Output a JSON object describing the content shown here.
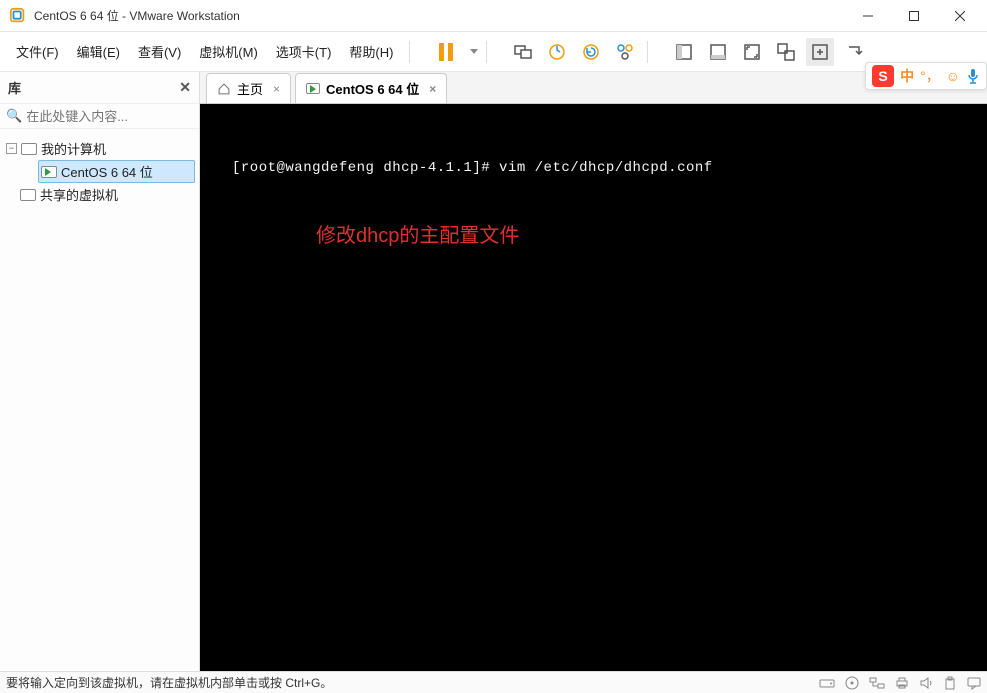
{
  "titlebar": {
    "title": "CentOS 6 64 位 - VMware Workstation"
  },
  "menu": {
    "file": "文件(F)",
    "edit": "编辑(E)",
    "view": "查看(V)",
    "vm": "虚拟机(M)",
    "tabs": "选项卡(T)",
    "help": "帮助(H)"
  },
  "sidebar": {
    "header": "库",
    "search_placeholder": "在此处键入内容...",
    "nodes": {
      "root": "我的计算机",
      "vm1": "CentOS 6 64 位",
      "shared": "共享的虚拟机"
    }
  },
  "tabs": {
    "home": "主页",
    "vm": "CentOS 6 64 位"
  },
  "terminal": {
    "line1": "[root@wangdefeng dhcp-4.1.1]# vim /etc/dhcp/dhcpd.conf"
  },
  "annotation": {
    "text": "修改dhcp的主配置文件"
  },
  "statusbar": {
    "msg": "要将输入定向到该虚拟机，请在虚拟机内部单击或按 Ctrl+G。"
  },
  "ime": {
    "zh": "中"
  }
}
